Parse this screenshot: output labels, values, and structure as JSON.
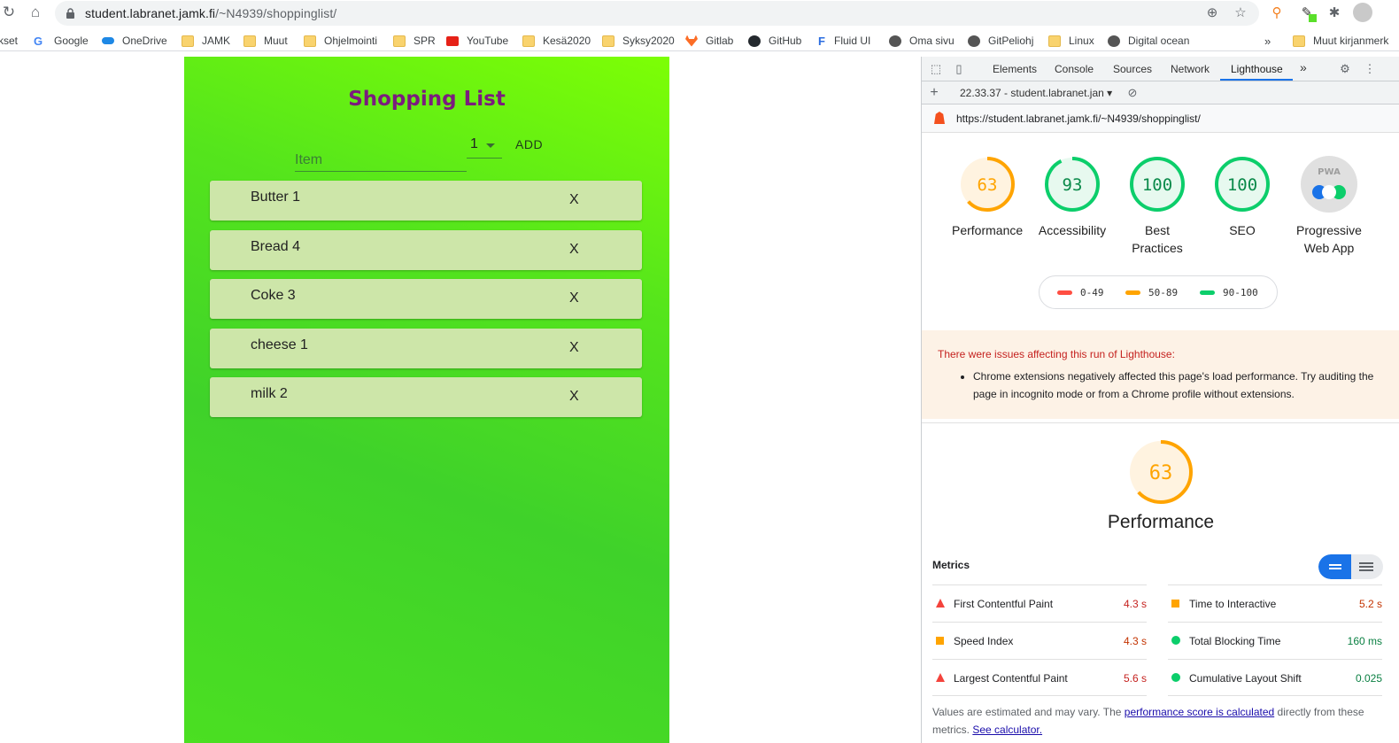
{
  "browser": {
    "url_host": "student.labranet.jamk.fi",
    "url_path": "/~N4939/shoppinglist/",
    "bookmarks": [
      {
        "label": "kset",
        "icon": "none"
      },
      {
        "label": "Google",
        "icon": "google-icon"
      },
      {
        "label": "OneDrive",
        "icon": "cloud-icon"
      },
      {
        "label": "JAMK",
        "icon": "folder-icon"
      },
      {
        "label": "Muut",
        "icon": "folder-icon"
      },
      {
        "label": "Ohjelmointi",
        "icon": "folder-icon"
      },
      {
        "label": "SPR",
        "icon": "folder-icon"
      },
      {
        "label": "YouTube",
        "icon": "youtube-icon"
      },
      {
        "label": "Kesä2020",
        "icon": "folder-icon"
      },
      {
        "label": "Syksy2020",
        "icon": "folder-icon"
      },
      {
        "label": "Gitlab",
        "icon": "gitlab-icon"
      },
      {
        "label": "GitHub",
        "icon": "github-icon"
      },
      {
        "label": "Fluid UI",
        "icon": "fluid-icon"
      },
      {
        "label": "Oma sivu",
        "icon": "globe-icon"
      },
      {
        "label": "GitPeliohj",
        "icon": "globe-icon"
      },
      {
        "label": "Linux",
        "icon": "folder-icon"
      },
      {
        "label": "Digital ocean",
        "icon": "globe-icon"
      },
      {
        "label": "Muut kirjanmerk",
        "icon": "folder-icon"
      }
    ],
    "more_bookmarks": "»"
  },
  "app": {
    "title": "Shopping List",
    "item_placeholder": "Item",
    "quantity": "1",
    "add_label": "ADD",
    "delete_label": "X",
    "items": [
      "Butter 1",
      "Bread 4",
      "Coke 3",
      "cheese 1",
      "milk 2"
    ],
    "colors": {
      "title": "#7b1c7e",
      "item_bg": "#cde6a9",
      "gradient_start": "#7dff05",
      "gradient_end": "#3fd22a"
    }
  },
  "devtools": {
    "tabs": [
      "Elements",
      "Console",
      "Sources",
      "Network",
      "Lighthouse"
    ],
    "active_tab": "Lighthouse",
    "more_tabs": "»",
    "report_selector": "22.33.37 - student.labranet.jan",
    "report_url": "https://student.labranet.jamk.fi/~N4939/shoppinglist/",
    "scores": [
      {
        "label": "Performance",
        "value": "63",
        "color": "#ffa400"
      },
      {
        "label": "Accessibility",
        "value": "93",
        "color": "#0cce6b"
      },
      {
        "label": "Best Practices",
        "value": "100",
        "color": "#0cce6b"
      },
      {
        "label": "SEO",
        "value": "100",
        "color": "#0cce6b"
      },
      {
        "label": "Progressive Web App",
        "value": "PWA",
        "color": "#9e9e9e"
      }
    ],
    "legend": [
      {
        "range": "0-49",
        "color": "#ff4e42"
      },
      {
        "range": "50-89",
        "color": "#ffa400"
      },
      {
        "range": "90-100",
        "color": "#0cce6b"
      }
    ],
    "warning": {
      "heading": "There were issues affecting this run of Lighthouse:",
      "item": "Chrome extensions negatively affected this page's load performance. Try auditing the page in incognito mode or from a Chrome profile without extensions."
    },
    "performance": {
      "score": "63",
      "title": "Performance"
    },
    "metrics_heading": "Metrics",
    "metrics": [
      {
        "name": "First Contentful Paint",
        "value": "4.3 s",
        "status": "fail"
      },
      {
        "name": "Time to Interactive",
        "value": "5.2 s",
        "status": "average"
      },
      {
        "name": "Speed Index",
        "value": "4.3 s",
        "status": "average"
      },
      {
        "name": "Total Blocking Time",
        "value": "160 ms",
        "status": "pass"
      },
      {
        "name": "Largest Contentful Paint",
        "value": "5.6 s",
        "status": "fail"
      },
      {
        "name": "Cumulative Layout Shift",
        "value": "0.025",
        "status": "pass"
      }
    ],
    "note": {
      "prefix": "Values are estimated and may vary. The ",
      "link1": "performance score is calculated",
      "mid": " directly from these metrics. ",
      "link2": "See calculator."
    }
  }
}
